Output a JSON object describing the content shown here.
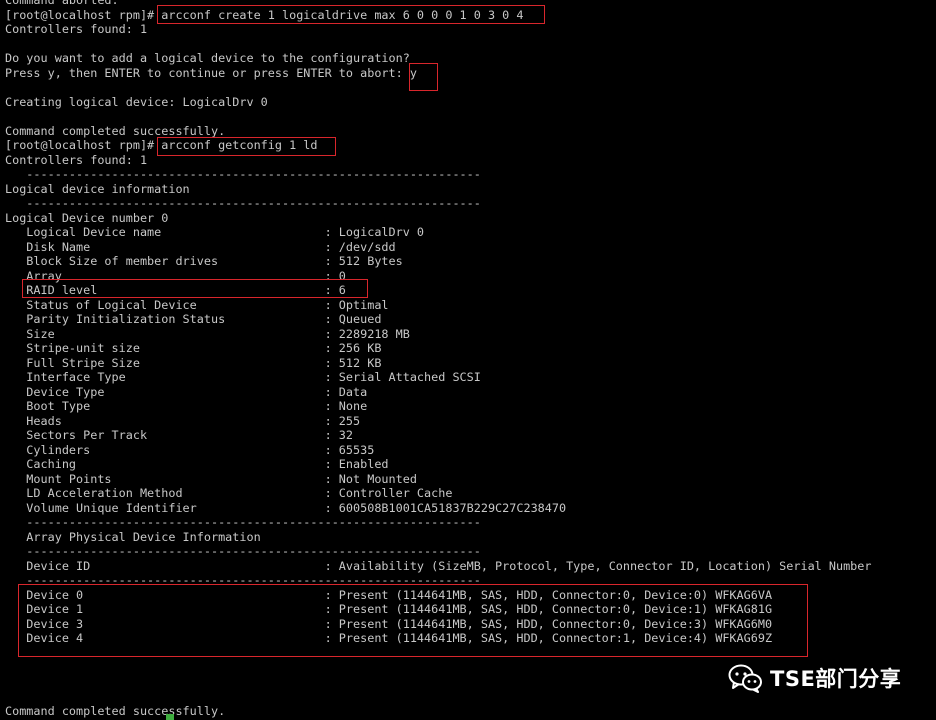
{
  "terminal": {
    "lines": [
      "Command aborted.",
      "[root@localhost rpm]# arcconf create 1 logicaldrive max 6 0 0 0 1 0 3 0 4",
      "Controllers found: 1",
      "",
      "Do you want to add a logical device to the configuration?",
      "Press y, then ENTER to continue or press ENTER to abort: y",
      "",
      "Creating logical device: LogicalDrv 0",
      "",
      "Command completed successfully.",
      "[root@localhost rpm]# arcconf getconfig 1 ld",
      "Controllers found: 1",
      "   ----------------------------------------------------------------",
      "Logical device information",
      "   ----------------------------------------------------------------",
      "Logical Device number 0",
      "   Logical Device name                       : LogicalDrv 0",
      "   Disk Name                                 : /dev/sdd",
      "   Block Size of member drives               : 512 Bytes",
      "   Array                                     : 0",
      "   RAID level                                : 6",
      "   Status of Logical Device                  : Optimal",
      "   Parity Initialization Status              : Queued",
      "   Size                                      : 2289218 MB",
      "   Stripe-unit size                          : 256 KB",
      "   Full Stripe Size                          : 512 KB",
      "   Interface Type                            : Serial Attached SCSI",
      "   Device Type                               : Data",
      "   Boot Type                                 : None",
      "   Heads                                     : 255",
      "   Sectors Per Track                         : 32",
      "   Cylinders                                 : 65535",
      "   Caching                                   : Enabled",
      "   Mount Points                              : Not Mounted",
      "   LD Acceleration Method                    : Controller Cache",
      "   Volume Unique Identifier                  : 600508B1001CA51837B229C27C238470",
      "   ----------------------------------------------------------------",
      "   Array Physical Device Information",
      "   ----------------------------------------------------------------",
      "   Device ID                                 : Availability (SizeMB, Protocol, Type, Connector ID, Location) Serial Number",
      "   ----------------------------------------------------------------",
      "   Device 0                                  : Present (1144641MB, SAS, HDD, Connector:0, Device:0) WFKAG6VA",
      "   Device 1                                  : Present (1144641MB, SAS, HDD, Connector:0, Device:1) WFKAG81G",
      "   Device 3                                  : Present (1144641MB, SAS, HDD, Connector:0, Device:3) WFKAG6M0",
      "   Device 4                                  : Present (1144641MB, SAS, HDD, Connector:1, Device:4) WFKAG69Z",
      "",
      "",
      "",
      "",
      "Command completed successfully."
    ]
  },
  "watermark": {
    "text": "TSE部门分享",
    "icon": "wechat-icon"
  },
  "colors": {
    "background": "#000000",
    "text": "#c8c8c8",
    "highlight_box": "#d8262c",
    "cursor": "#3fae3f"
  }
}
